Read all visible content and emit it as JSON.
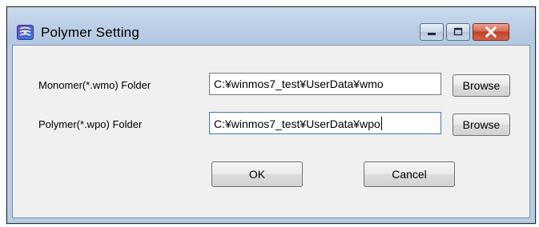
{
  "window": {
    "title": "Polymer Setting",
    "icon": "polymer-app-icon",
    "controls": {
      "minimize_icon": "minimize-icon",
      "maximize_icon": "maximize-icon",
      "close_icon": "close-icon"
    }
  },
  "form": {
    "monomer": {
      "label": "Monomer(*.wmo) Folder",
      "value": "C:¥winmos7_test¥UserData¥wmo",
      "browse_label": "Browse"
    },
    "polymer": {
      "label": "Polymer(*.wpo) Folder",
      "value": "C:¥winmos7_test¥UserData¥wpo",
      "browse_label": "Browse"
    }
  },
  "actions": {
    "ok_label": "OK",
    "cancel_label": "Cancel"
  },
  "colors": {
    "titlebar": "#b9cde4",
    "client": "#f0f0f0",
    "close_button": "#c9452e",
    "focus_border": "#3b79c9"
  }
}
